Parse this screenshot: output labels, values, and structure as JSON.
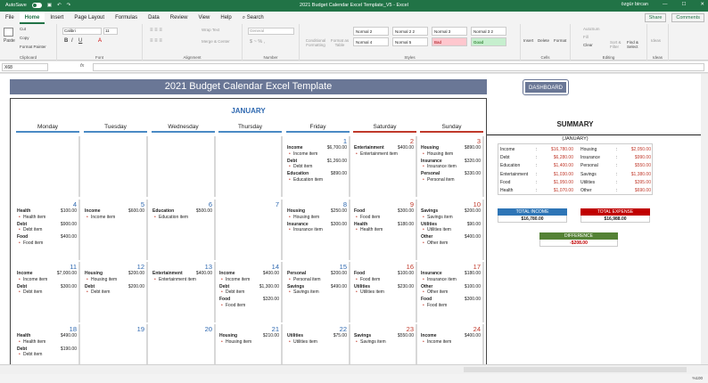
{
  "titlebar": {
    "autosave": "AutoSave",
    "title": "2021 Budget Calendar Excel Template_V5  -  Excel",
    "search": "Search",
    "user": "özgür bircan"
  },
  "menu": {
    "tabs": [
      "File",
      "Home",
      "Insert",
      "Page Layout",
      "Formulas",
      "Data",
      "Review",
      "View",
      "Help"
    ],
    "active": 1,
    "share": "Share",
    "comments": "Comments"
  },
  "ribbon": {
    "clipboard": {
      "paste": "Paste",
      "cut": "Cut",
      "copy": "Copy",
      "format_painter": "Format Painter",
      "label": "Clipboard"
    },
    "font": {
      "name": "Calibri",
      "size": "11",
      "label": "Font"
    },
    "alignment": {
      "wrap": "Wrap Text",
      "merge": "Merge & Center",
      "label": "Alignment"
    },
    "number": {
      "format": "General",
      "label": "Number"
    },
    "styles": {
      "cond": "Conditional Formatting",
      "fmt_table": "Format as Table",
      "cells": [
        "Normal 2",
        "Normal 2 2",
        "Normal 3",
        "Normal 3 2",
        "Normal 4",
        "Normal 5",
        "Bad",
        "Good"
      ],
      "label": "Styles"
    },
    "cells": {
      "insert": "Insert",
      "delete": "Delete",
      "format": "Format",
      "label": "Cells"
    },
    "editing": {
      "autosum": "AutoSum",
      "fill": "Fill",
      "clear": "Clear",
      "sort": "Sort & Filter",
      "find": "Find & Select",
      "label": "Editing"
    },
    "ideas": {
      "ideas": "Ideas",
      "label": "Ideas"
    }
  },
  "formula_bar": {
    "name_box": "X68",
    "fx": "fx",
    "content": ""
  },
  "sheet": {
    "banner": "2021 Budget Calendar Excel Template",
    "dashboard_button": "DASHBOARD",
    "month": "JANUARY",
    "days": [
      "Monday",
      "Tuesday",
      "Wednesday",
      "Thursday",
      "Friday",
      "Saturday",
      "Sunday"
    ],
    "weeks": [
      [
        null,
        null,
        null,
        null,
        {
          "d": "1",
          "e": [
            {
              "c": "Income",
              "a": "$6,700.00",
              "i": "Income item"
            },
            {
              "c": "Debt",
              "a": "$1,260.00",
              "i": "Debt item"
            },
            {
              "c": "Education",
              "a": "$890.00",
              "i": "Education item"
            }
          ]
        },
        {
          "d": "2",
          "e": [
            {
              "c": "Entertainment",
              "a": "$400.00",
              "i": "Entertainment item"
            }
          ]
        },
        {
          "d": "3",
          "e": [
            {
              "c": "Housing",
              "a": "$890.00",
              "i": "Housing item"
            },
            {
              "c": "Insurance",
              "a": "$320.00",
              "i": "Insurance item"
            },
            {
              "c": "Personal",
              "a": "$330.00",
              "i": "Personal item"
            }
          ]
        }
      ],
      [
        {
          "d": "4",
          "e": [
            {
              "c": "Health",
              "a": "$100.00",
              "i": "Health item"
            },
            {
              "c": "Debt",
              "a": "$900.00",
              "i": "Debt item"
            },
            {
              "c": "Food",
              "a": "$400.00",
              "i": "Food item"
            }
          ]
        },
        {
          "d": "5",
          "e": [
            {
              "c": "Income",
              "a": "$600.00",
              "i": "Income item"
            }
          ]
        },
        {
          "d": "6",
          "e": [
            {
              "c": "Education",
              "a": "$500.00",
              "i": "Education item"
            }
          ]
        },
        {
          "d": "7",
          "e": []
        },
        {
          "d": "8",
          "e": [
            {
              "c": "Housing",
              "a": "$250.00",
              "i": "Housing item"
            },
            {
              "c": "Insurance",
              "a": "$300.00",
              "i": "Insurance item"
            }
          ]
        },
        {
          "d": "9",
          "e": [
            {
              "c": "Food",
              "a": "$300.00",
              "i": "Food item"
            },
            {
              "c": "Health",
              "a": "$180.00",
              "i": "Health item"
            }
          ]
        },
        {
          "d": "10",
          "e": [
            {
              "c": "Savings",
              "a": "$200.00",
              "i": "Savings item"
            },
            {
              "c": "Utilities",
              "a": "$90.00",
              "i": "Utilities item"
            },
            {
              "c": "Other",
              "a": "$400.00",
              "i": "Other item"
            }
          ]
        }
      ],
      [
        {
          "d": "11",
          "e": [
            {
              "c": "Income",
              "a": "$7,000.00",
              "i": "Income item"
            },
            {
              "c": "Debt",
              "a": "$300.00",
              "i": "Debt item"
            }
          ]
        },
        {
          "d": "12",
          "e": [
            {
              "c": "Housing",
              "a": "$200.00",
              "i": "Housing item"
            },
            {
              "c": "Debt",
              "a": "$200.00",
              "i": "Debt item"
            }
          ]
        },
        {
          "d": "13",
          "e": [
            {
              "c": "Entertainment",
              "a": "$400.00",
              "i": "Entertainment item"
            }
          ]
        },
        {
          "d": "14",
          "e": [
            {
              "c": "Income",
              "a": "$400.00",
              "i": "Income item"
            },
            {
              "c": "Debt",
              "a": "$1,300.00",
              "i": "Debt item"
            },
            {
              "c": "Food",
              "a": "$320.00",
              "i": "Food item"
            }
          ]
        },
        {
          "d": "15",
          "e": [
            {
              "c": "Personal",
              "a": "$200.00",
              "i": "Personal item"
            },
            {
              "c": "Savings",
              "a": "$490.00",
              "i": "Savings item"
            }
          ]
        },
        {
          "d": "16",
          "e": [
            {
              "c": "Food",
              "a": "$100.00",
              "i": "Food item"
            },
            {
              "c": "Utilities",
              "a": "$230.00",
              "i": "Utilities item"
            }
          ]
        },
        {
          "d": "17",
          "e": [
            {
              "c": "Insurance",
              "a": "$180.00",
              "i": "Insurance item"
            },
            {
              "c": "Other",
              "a": "$100.00",
              "i": "Other item"
            },
            {
              "c": "Food",
              "a": "$300.00",
              "i": "Food item"
            }
          ]
        }
      ],
      [
        {
          "d": "18",
          "e": [
            {
              "c": "Health",
              "a": "$490.00",
              "i": "Health item"
            },
            {
              "c": "Debt",
              "a": "$190.00",
              "i": "Debt item"
            }
          ]
        },
        {
          "d": "19",
          "e": []
        },
        {
          "d": "20",
          "e": []
        },
        {
          "d": "21",
          "e": [
            {
              "c": "Housing",
              "a": "$210.00",
              "i": "Housing item"
            }
          ]
        },
        {
          "d": "22",
          "e": [
            {
              "c": "Utilities",
              "a": "$75.00",
              "i": "Utilities item"
            }
          ]
        },
        {
          "d": "23",
          "e": [
            {
              "c": "Savings",
              "a": "$550.00",
              "i": "Savings item"
            }
          ]
        },
        {
          "d": "24",
          "e": [
            {
              "c": "Income",
              "a": "$400.00",
              "i": "Income item"
            }
          ]
        }
      ]
    ],
    "summary": {
      "title": "SUMMARY",
      "month": "(JANUARY)",
      "left": [
        [
          "Income",
          "$16,780.00"
        ],
        [
          "Debt",
          "$6,280.00"
        ],
        [
          "Education",
          "$1,400.00"
        ],
        [
          "Entertainment",
          "$1,030.00"
        ],
        [
          "Food",
          "$1,950.00"
        ],
        [
          "Health",
          "$1,070.00"
        ]
      ],
      "right": [
        [
          "Housing",
          "$2,050.00"
        ],
        [
          "Insurance",
          "$990.00"
        ],
        [
          "Personal",
          "$550.00"
        ],
        [
          "Savings",
          "$1,380.00"
        ],
        [
          "Utilities",
          "$395.00"
        ],
        [
          "Other",
          "$690.00"
        ]
      ],
      "total_income_label": "TOTAL INCOME",
      "total_income": "$16,780.00",
      "total_expense_label": "TOTAL EXPENSE",
      "total_expense": "$16,988.00",
      "difference_label": "DIFFERENCE",
      "difference": "-$208.00"
    }
  },
  "status": {
    "zoom": "%100"
  },
  "colors": {
    "excel_green": "#217346",
    "banner": "#6a7796",
    "blue": "#2e68b0",
    "red": "#c0392b",
    "income_blue": "#2e75b6",
    "expense_red": "#c00000",
    "diff_green": "#548235"
  }
}
